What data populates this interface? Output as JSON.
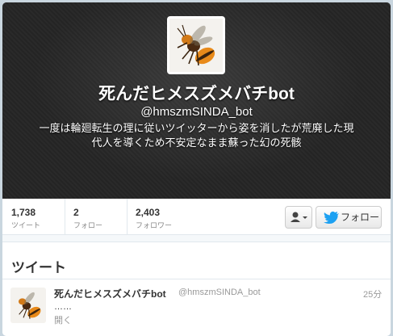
{
  "profile": {
    "name": "死んだヒメスズメバチbot",
    "handle": "@hmszmSINDA_bot",
    "bio": "一度は輪廻転生の理に従いツイッターから姿を消したが荒廃した現代人を導くため不安定なまま蘇った幻の死骸",
    "avatar_icon": "hornet-photo"
  },
  "stats": [
    {
      "value": "1,738",
      "label": "ツイート"
    },
    {
      "value": "2",
      "label": "フォロー"
    },
    {
      "value": "2,403",
      "label": "フォロワー"
    }
  ],
  "actions": {
    "user_icon": "user-dropdown-icon",
    "follow_label": "フォロー",
    "follow_icon": "twitter-bird-icon"
  },
  "timeline": {
    "title": "ツイート",
    "tweet": {
      "name": "死んだヒメスズメバチbot",
      "handle": "@hmszmSINDA_bot",
      "time": "25分",
      "text": "……",
      "open_label": "開く"
    }
  },
  "colors": {
    "accent": "#1da1f2",
    "header_bg": "#262626",
    "hornet_orange": "#e88a1a"
  }
}
